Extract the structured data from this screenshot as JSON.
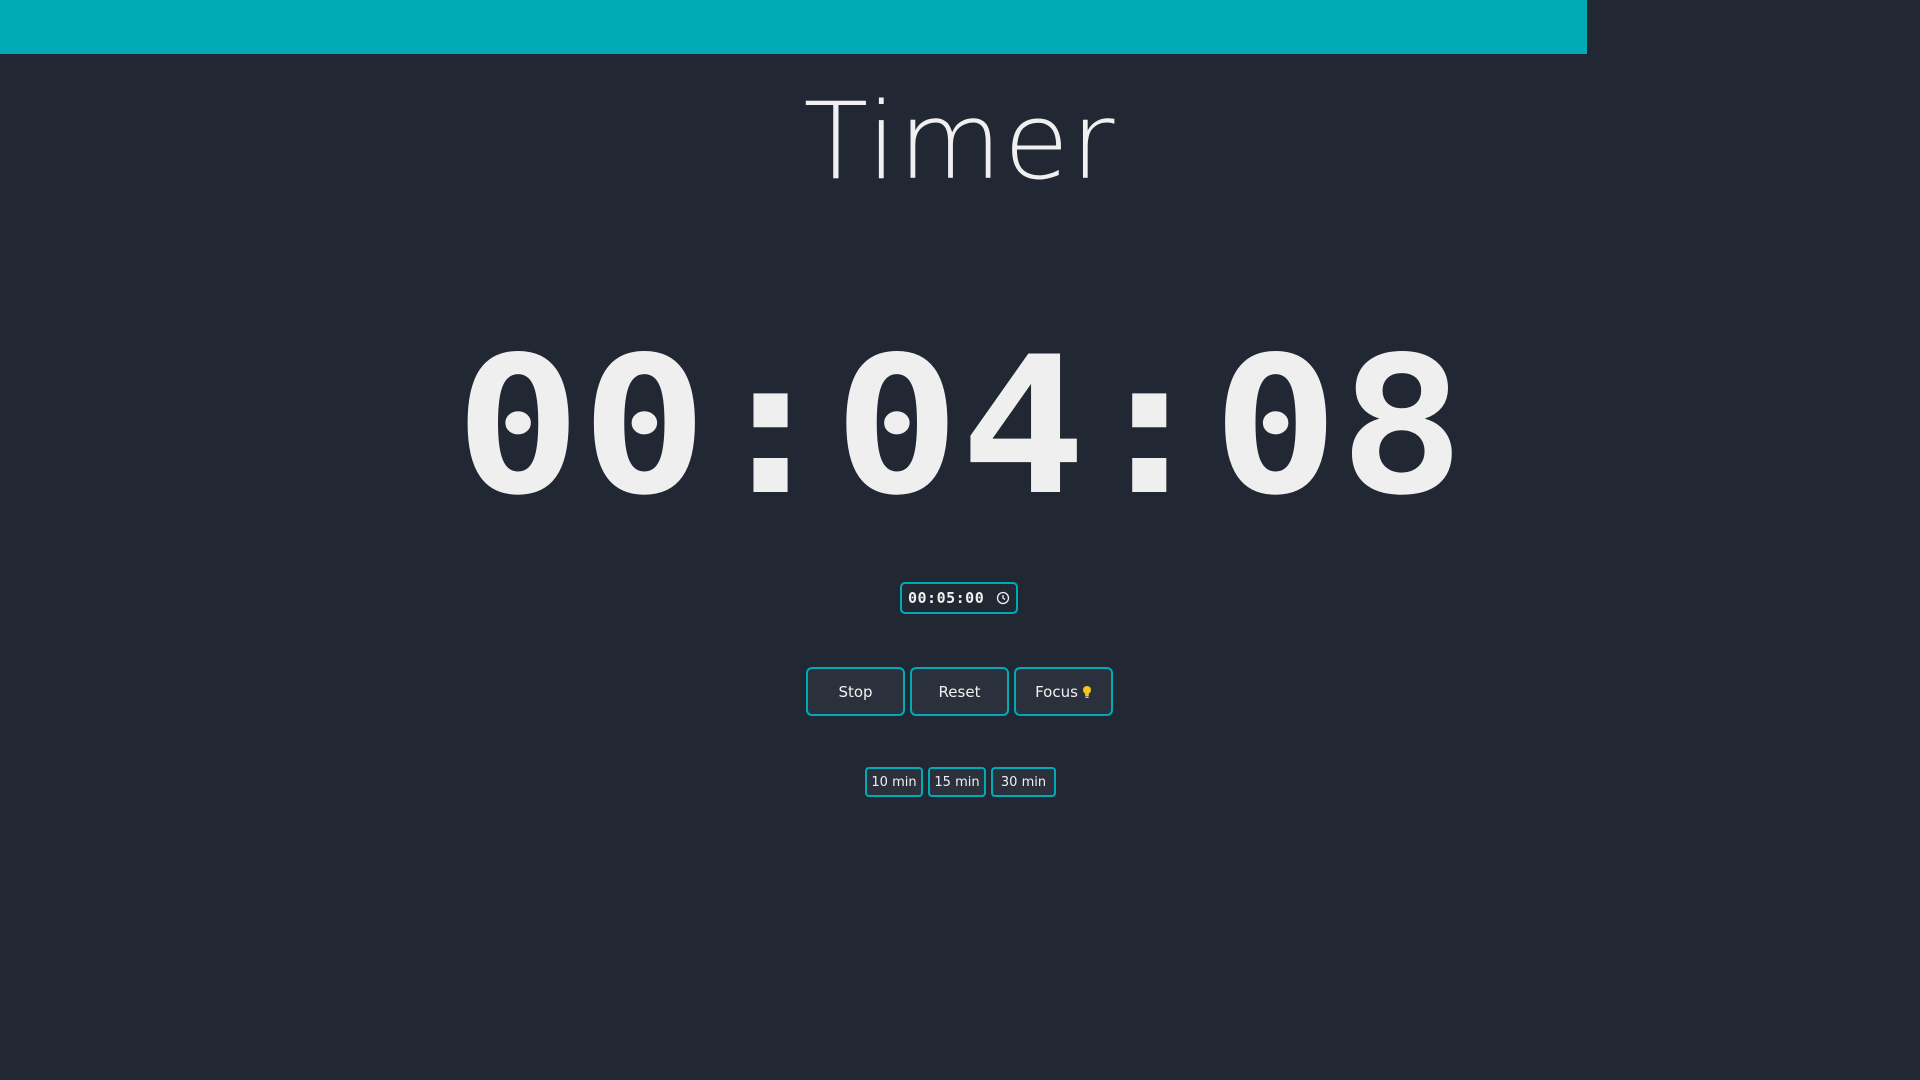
{
  "page": {
    "title": "Timer"
  },
  "clock": {
    "display": "00:04:08"
  },
  "duration_input": {
    "value": "00:05:00",
    "icon": "clock-icon"
  },
  "controls": {
    "stop_label": "Stop",
    "reset_label": "Reset",
    "focus_label": "Focus",
    "focus_icon": "lightbulb-icon"
  },
  "presets": [
    {
      "label": "10 min"
    },
    {
      "label": "15 min"
    },
    {
      "label": "30 min"
    }
  ],
  "colors": {
    "accent": "#00abb5",
    "background": "#222833",
    "button_bg": "#2b313c",
    "text": "#f0f0f0",
    "bulb": "#f5c518"
  }
}
